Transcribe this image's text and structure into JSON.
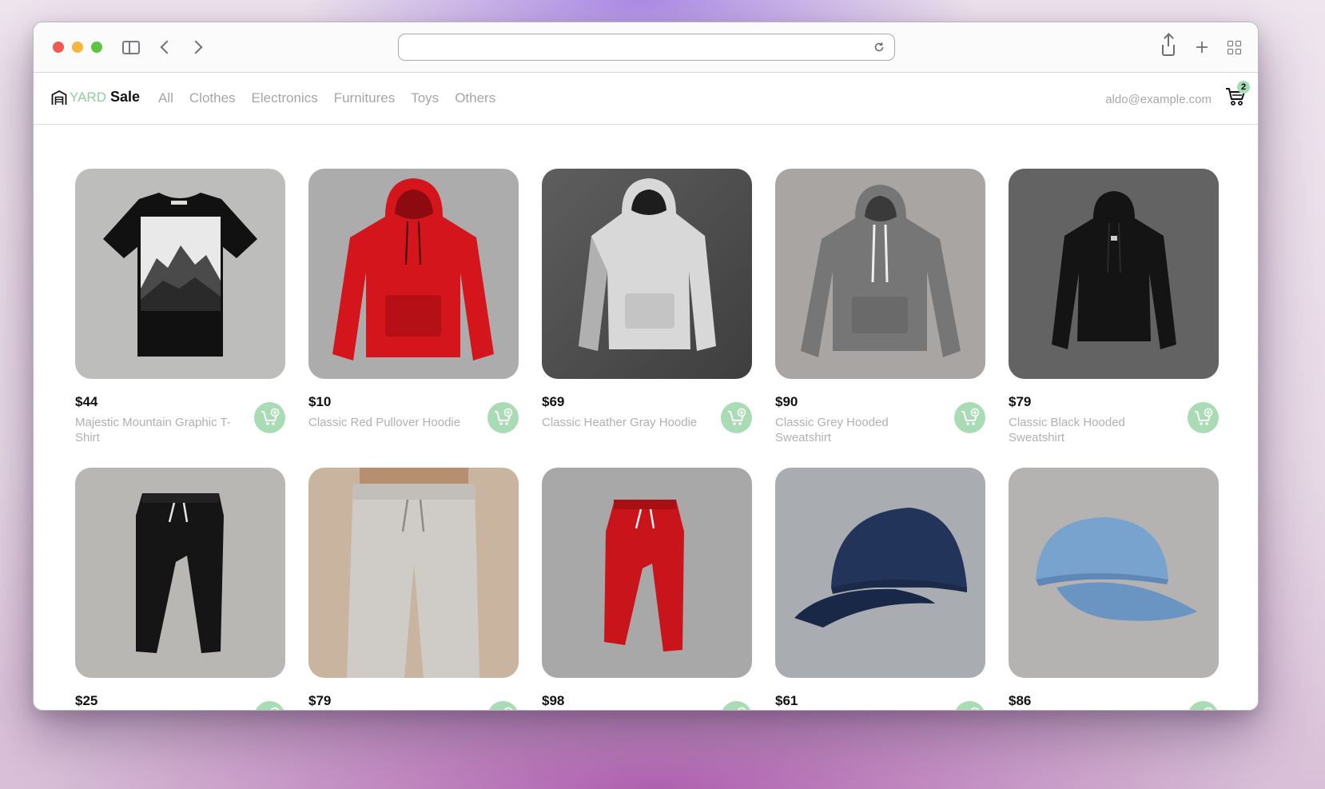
{
  "browser": {
    "address": "",
    "icons": [
      "sidebar-icon",
      "back-icon",
      "forward-icon",
      "reload-icon",
      "share-icon",
      "new-tab-icon",
      "tab-overview-icon"
    ]
  },
  "site": {
    "logo_yard": "YARD",
    "logo_sale": "Sale",
    "nav": [
      "All",
      "Clothes",
      "Electronics",
      "Furnitures",
      "Toys",
      "Others"
    ],
    "user_email": "aldo@example.com",
    "cart_count": "2"
  },
  "products": [
    {
      "price": "$44",
      "title": "Majestic Mountain Graphic T-Shirt",
      "image": "black t-shirt with mountain print"
    },
    {
      "price": "$10",
      "title": "Classic Red Pullover Hoodie",
      "image": "red hoodie"
    },
    {
      "price": "$69",
      "title": "Classic Heather Gray Hoodie",
      "image": "light gray hoodie"
    },
    {
      "price": "$90",
      "title": "Classic Grey Hooded Sweatshirt",
      "image": "grey hooded sweatshirt"
    },
    {
      "price": "$79",
      "title": "Classic Black Hooded Sweatshirt",
      "image": "black hooded sweatshirt"
    },
    {
      "price": "$25",
      "title": "",
      "image": "black joggers"
    },
    {
      "price": "$79",
      "title": "",
      "image": "light gray sweatpants"
    },
    {
      "price": "$98",
      "title": "",
      "image": "red joggers"
    },
    {
      "price": "$61",
      "title": "",
      "image": "navy baseball cap"
    },
    {
      "price": "$86",
      "title": "",
      "image": "light blue baseball cap"
    }
  ],
  "colors": {
    "accent_green": "#a9dcb4",
    "logo_green": "#8fcf9c",
    "muted_text": "#b0b0b0"
  }
}
